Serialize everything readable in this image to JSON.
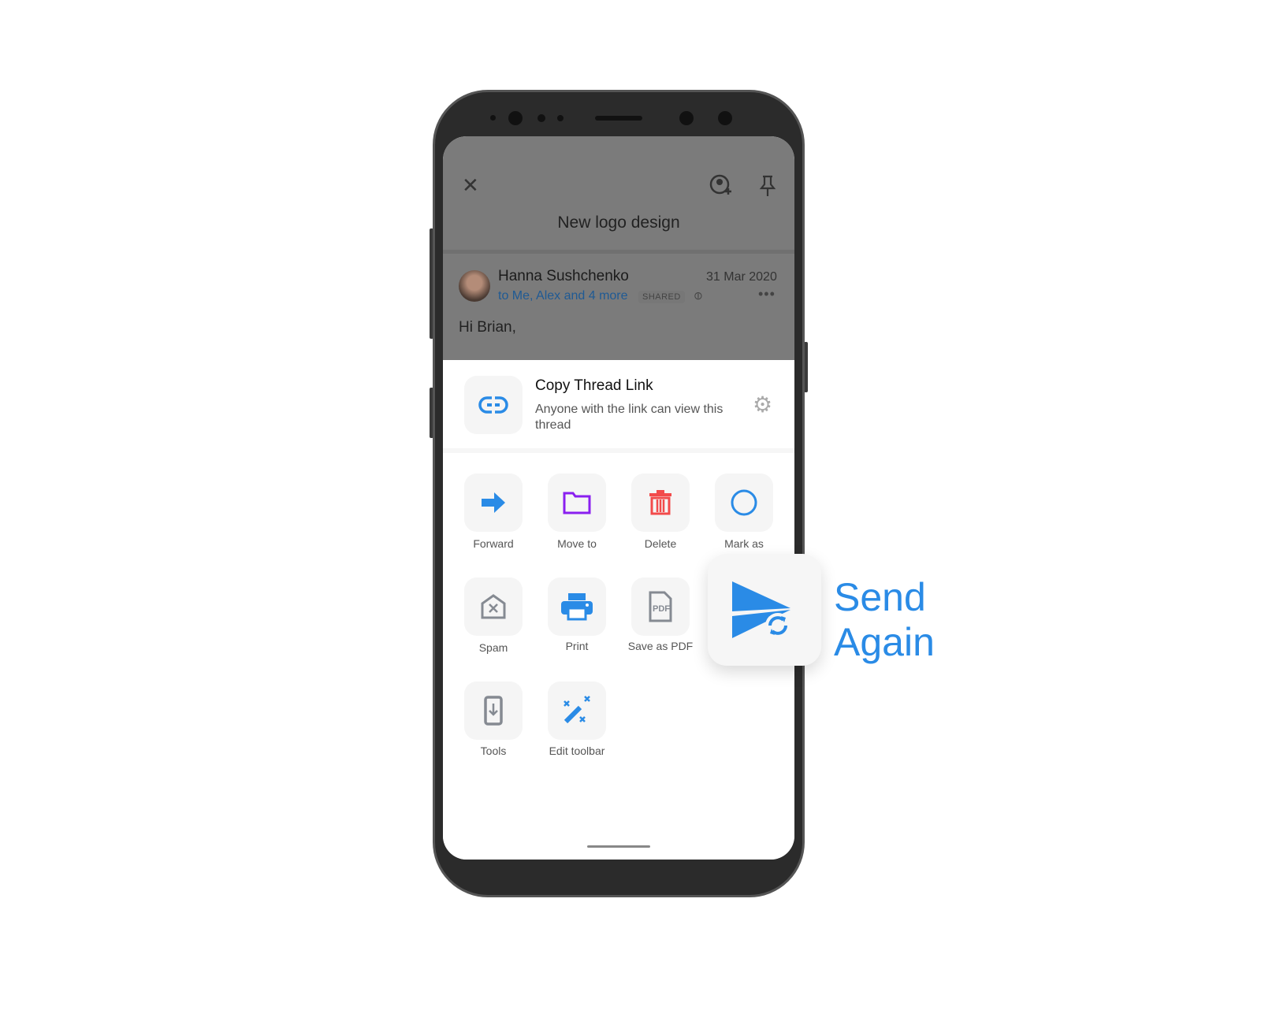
{
  "header": {
    "title": "New logo design"
  },
  "message": {
    "sender": "Hanna Sushchenko",
    "date": "31 Mar 2020",
    "recipients": "to Me, Alex and 4 more",
    "badge": "SHARED",
    "body": "Hi Brian,"
  },
  "link_card": {
    "title": "Copy Thread Link",
    "subtitle": "Anyone with the link can view this thread"
  },
  "actions": [
    {
      "label": "Forward"
    },
    {
      "label": "Move to"
    },
    {
      "label": "Delete"
    },
    {
      "label": "Mark as"
    },
    {
      "label": "Spam"
    },
    {
      "label": "Print"
    },
    {
      "label": "Save as PDF"
    },
    {
      "label": "Tools"
    },
    {
      "label": "Edit toolbar"
    }
  ],
  "callout": {
    "line1": "Send",
    "line2": "Again"
  },
  "colors": {
    "accent": "#2a8be6",
    "purple": "#8a1ff0",
    "red": "#f24b4b",
    "gray_icon": "#858a92"
  }
}
